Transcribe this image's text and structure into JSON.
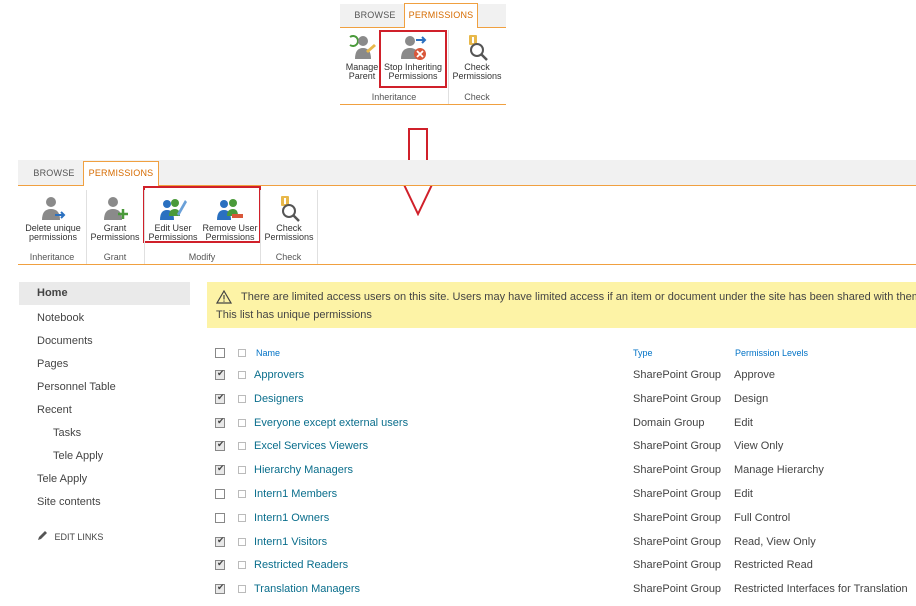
{
  "top_ribbon": {
    "tabs": [
      "BROWSE",
      "PERMISSIONS"
    ],
    "buttons": [
      {
        "label_line1": "Manage",
        "label_line2": "Parent"
      },
      {
        "label_line1": "Stop Inheriting",
        "label_line2": "Permissions"
      },
      {
        "label_line1": "Check",
        "label_line2": "Permissions"
      }
    ],
    "groups": [
      "Inheritance",
      "Check"
    ]
  },
  "main_ribbon": {
    "tabs": [
      "BROWSE",
      "PERMISSIONS"
    ],
    "buttons": [
      {
        "label_line1": "Delete unique",
        "label_line2": "permissions"
      },
      {
        "label_line1": "Grant",
        "label_line2": "Permissions"
      },
      {
        "label_line1": "Edit User",
        "label_line2": "Permissions"
      },
      {
        "label_line1": "Remove User",
        "label_line2": "Permissions"
      },
      {
        "label_line1": "Check",
        "label_line2": "Permissions"
      }
    ],
    "groups": [
      "Inheritance",
      "Grant",
      "Modify",
      "Check"
    ]
  },
  "nav": {
    "items": [
      "Home",
      "Notebook",
      "Documents",
      "Pages",
      "Personnel Table",
      "Recent",
      "Tasks",
      "Tele Apply",
      "Tele Apply",
      "Site contents"
    ],
    "edit_links": "EDIT LINKS"
  },
  "banner": {
    "line1": "There are limited access users on this site. Users may have limited access if an item or document under the site has been shared with them",
    "line2": "This list has unique permissions"
  },
  "table": {
    "headers": {
      "name": "Name",
      "type": "Type",
      "levels": "Permission Levels"
    },
    "rows": [
      {
        "name": "Approvers",
        "type": "SharePoint Group",
        "levels": "Approve",
        "checked": true
      },
      {
        "name": "Designers",
        "type": "SharePoint Group",
        "levels": "Design",
        "checked": true
      },
      {
        "name": "Everyone except external users",
        "type": "Domain Group",
        "levels": "Edit",
        "checked": true
      },
      {
        "name": "Excel Services Viewers",
        "type": "SharePoint Group",
        "levels": "View Only",
        "checked": true
      },
      {
        "name": "Hierarchy Managers",
        "type": "SharePoint Group",
        "levels": "Manage Hierarchy",
        "checked": true
      },
      {
        "name": "Intern1 Members",
        "type": "SharePoint Group",
        "levels": "Edit",
        "checked": false
      },
      {
        "name": "Intern1 Owners",
        "type": "SharePoint Group",
        "levels": "Full Control",
        "checked": false
      },
      {
        "name": "Intern1 Visitors",
        "type": "SharePoint Group",
        "levels": "Read, View Only",
        "checked": true
      },
      {
        "name": "Restricted Readers",
        "type": "SharePoint Group",
        "levels": "Restricted Read",
        "checked": true
      },
      {
        "name": "Translation Managers",
        "type": "SharePoint Group",
        "levels": "Restricted Interfaces for Translation",
        "checked": true
      }
    ]
  },
  "colors": {
    "accent": "#f0a040",
    "highlight_box": "#d0202a",
    "banner_bg": "#fdf3a6",
    "link": "#0a6e8c"
  }
}
